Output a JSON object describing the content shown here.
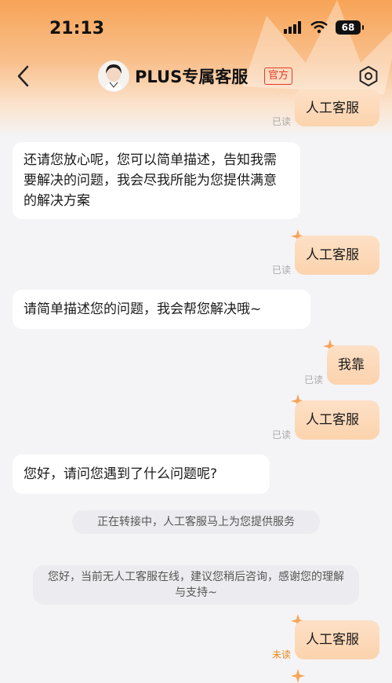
{
  "status_bar": {
    "time": "21:13",
    "battery": "68"
  },
  "nav": {
    "title": "PLUS专属客服",
    "badge": "官方"
  },
  "messages": {
    "m1": {
      "text": "人工客服",
      "status": "已读"
    },
    "m2": {
      "text": "还请您放心呢，您可以简单描述，告知我需要解决的问题，我会尽我所能为您提供满意的解决方案"
    },
    "m3": {
      "text": "人工客服",
      "status": "已读"
    },
    "m4": {
      "text": "请简单描述您的问题，我会帮您解决哦~"
    },
    "m5": {
      "text": "我靠",
      "status": "已读"
    },
    "m6": {
      "text": "人工客服",
      "status": "已读"
    },
    "m7": {
      "text": "您好，请问您遇到了什么问题呢?"
    },
    "tip1": {
      "text": "正在转接中，人工客服马上为您提供服务"
    },
    "tip2": {
      "text": "您好，当前无人工客服在线，建议您稍后咨询，感谢您的理解与支持~"
    },
    "m8": {
      "text": "人工客服",
      "status": "未读"
    }
  },
  "colors": {
    "header": "#f7a457",
    "out_bubble": "#fcd3ad",
    "badge": "#e4392c",
    "unread": "#e8871a"
  }
}
